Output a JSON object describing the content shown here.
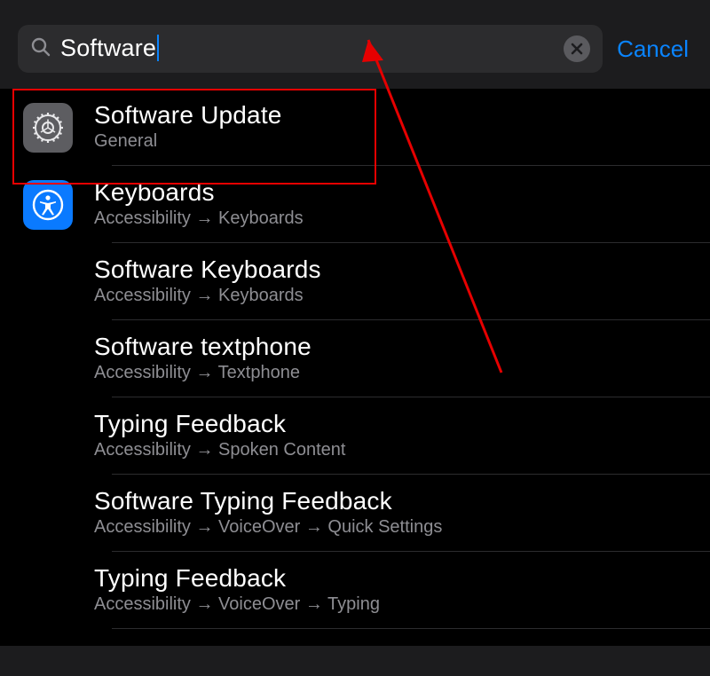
{
  "search": {
    "query": "Software",
    "cancel_label": "Cancel"
  },
  "results": [
    {
      "title": "Software Update",
      "breadcrumb": "General",
      "icon": "general"
    },
    {
      "title": "Keyboards",
      "breadcrumb": "Accessibility → Keyboards",
      "icon": "accessibility"
    },
    {
      "title": "Software Keyboards",
      "breadcrumb": "Accessibility → Keyboards",
      "icon": null
    },
    {
      "title": "Software textphone",
      "breadcrumb": "Accessibility → Textphone",
      "icon": null
    },
    {
      "title": "Typing Feedback",
      "breadcrumb": "Accessibility → Spoken Content",
      "icon": null
    },
    {
      "title": "Software Typing Feedback",
      "breadcrumb": "Accessibility → VoiceOver → Quick Settings",
      "icon": null
    },
    {
      "title": "Typing Feedback",
      "breadcrumb": "Accessibility → VoiceOver → Typing",
      "icon": null
    }
  ]
}
